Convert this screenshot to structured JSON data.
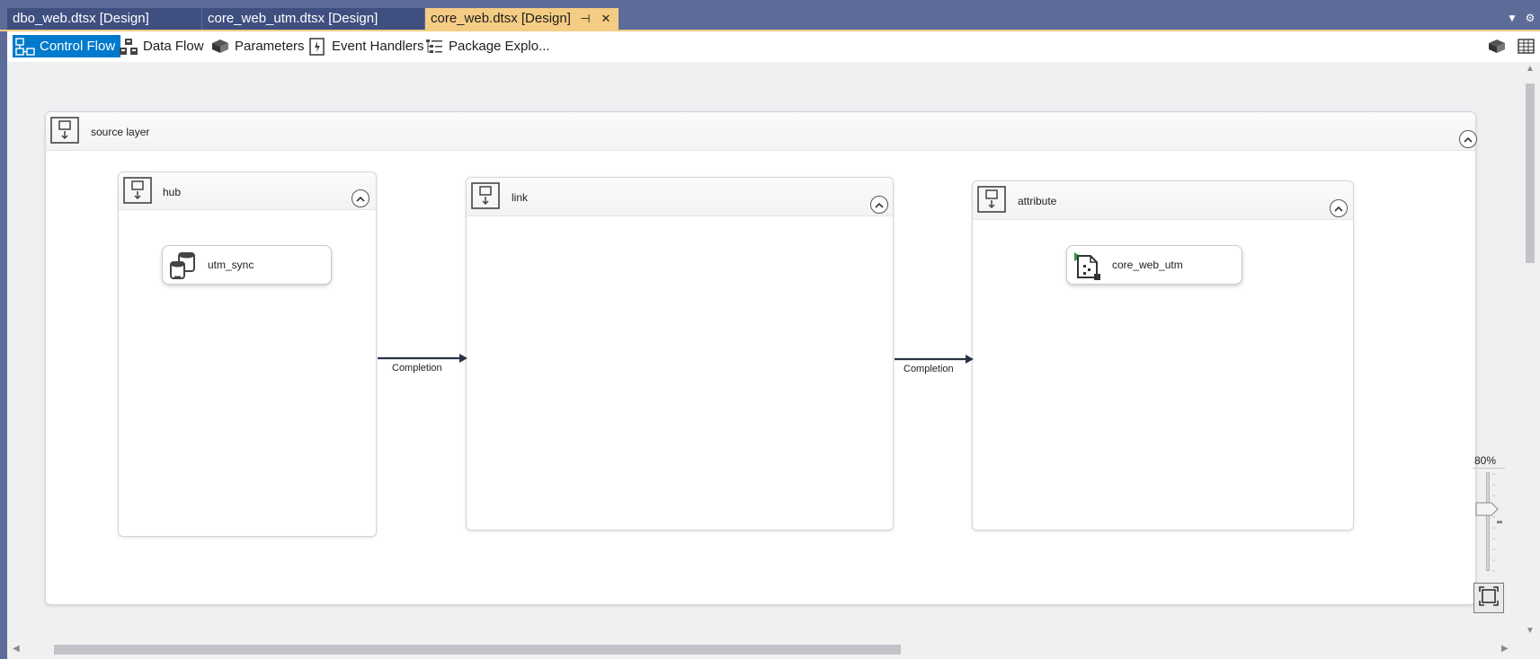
{
  "tabs": [
    {
      "label": "dbo_web.dtsx [Design]",
      "active": false
    },
    {
      "label": "core_web_utm.dtsx [Design]",
      "active": false
    },
    {
      "label": "core_web.dtsx [Design]",
      "active": true
    }
  ],
  "tab_strip": {
    "pin_glyph": "⊣",
    "close_glyph": "✕",
    "dropdown_glyph": "▼",
    "settings_glyph": "⚙"
  },
  "toolbar": {
    "items": [
      {
        "label": "Control Flow",
        "icon": "control-flow-icon",
        "active": true
      },
      {
        "label": "Data Flow",
        "icon": "data-flow-icon",
        "active": false
      },
      {
        "label": "Parameters",
        "icon": "parameters-icon",
        "active": false
      },
      {
        "label": "Event Handlers",
        "icon": "event-handlers-icon",
        "active": false
      },
      {
        "label": "Package Explo...",
        "icon": "package-explorer-icon",
        "active": false
      }
    ],
    "right_icons": [
      "variables-icon",
      "table-grid-icon"
    ]
  },
  "canvas": {
    "outer_container": {
      "title": "source layer"
    },
    "containers": [
      {
        "title": "hub",
        "tasks": [
          "utm_sync"
        ]
      },
      {
        "title": "link",
        "tasks": []
      },
      {
        "title": "attribute",
        "tasks": [
          "core_web_utm"
        ]
      }
    ],
    "constraints": [
      {
        "from": "hub",
        "to": "link",
        "label": "Completion"
      },
      {
        "from": "link",
        "to": "attribute",
        "label": "Completion"
      }
    ]
  },
  "zoom": {
    "label": "80%",
    "level": 0.63
  },
  "colors": {
    "tab_bar": "#5d6b99",
    "active_tab": "#f5cc84",
    "selected_toolbar": "#007acc",
    "canvas": "#eff0f1"
  }
}
